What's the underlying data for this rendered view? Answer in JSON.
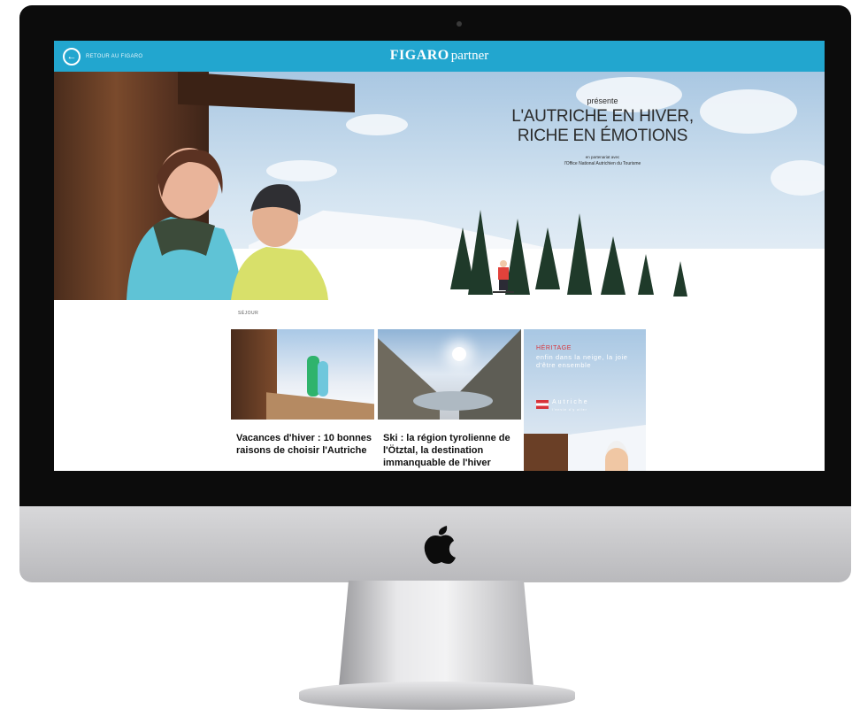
{
  "site": {
    "back_label": "RETOUR AU FIGARO",
    "brand_bold": "FIGARO",
    "brand_light": "partner"
  },
  "hero": {
    "presents": "présente",
    "headline_line1": "L'AUTRICHE EN HIVER,",
    "headline_line2": "RICHE EN ÉMOTIONS",
    "partner_intro": "en partenariat avec",
    "partner_name": "l'Office National Autrichien du Tourisme"
  },
  "section": {
    "label": "SÉJOUR"
  },
  "articles": [
    {
      "title": "Vacances d'hiver : 10 bonnes raisons de choisir l'Autriche"
    },
    {
      "title": "Ski : la région tyrolienne de l'Ötztal, la destination immanquable de l'hiver"
    }
  ],
  "ad": {
    "kicker": "HÉRITAGE",
    "body": "enfin dans la neige, la joie d'être ensemble",
    "brand": "Autriche",
    "tag": "l'envie d'y aller"
  },
  "colors": {
    "topbar": "#22a6cf",
    "bezel": "#0c0c0c"
  },
  "icons": [
    "back-arrow-icon",
    "apple-logo-icon"
  ]
}
